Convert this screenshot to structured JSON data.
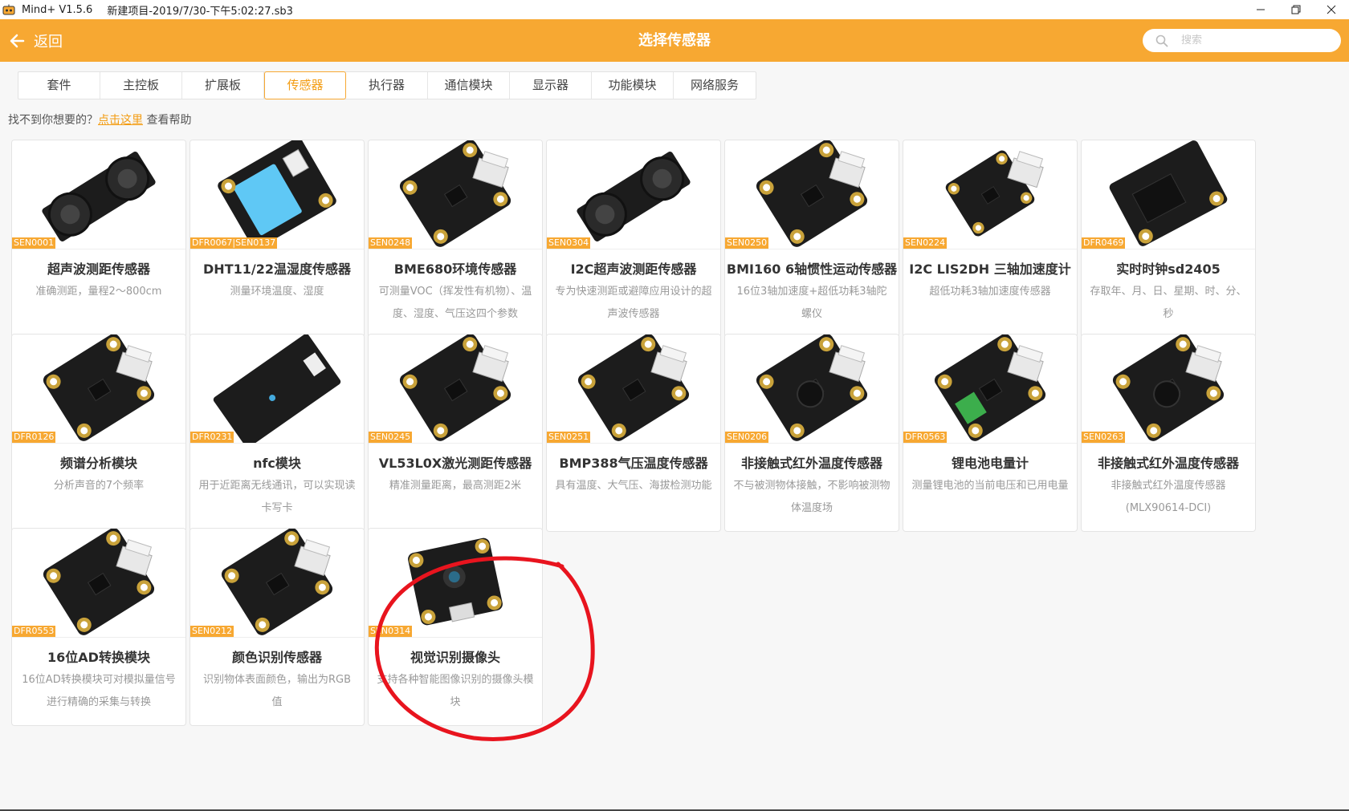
{
  "window": {
    "app_name": "Mind+ V1.5.6",
    "project_name": "新建项目-2019/7/30-下午5:02:27.sb3",
    "controls": [
      "minimize-icon",
      "restore-icon",
      "close-icon"
    ]
  },
  "header": {
    "back_label": "返回",
    "title": "选择传感器",
    "search_placeholder": "搜索",
    "search_value": ""
  },
  "tabs": [
    {
      "label": "套件",
      "active": false
    },
    {
      "label": "主控板",
      "active": false
    },
    {
      "label": "扩展板",
      "active": false
    },
    {
      "label": "传感器",
      "active": true
    },
    {
      "label": "执行器",
      "active": false
    },
    {
      "label": "通信模块",
      "active": false
    },
    {
      "label": "显示器",
      "active": false
    },
    {
      "label": "功能模块",
      "active": false
    },
    {
      "label": "网络服务",
      "active": false
    }
  ],
  "help": {
    "prefix": "找不到你想要的？",
    "link": "点击这里",
    "suffix": " 查看帮助"
  },
  "cards": [
    {
      "sku": "SEN0001",
      "name": "超声波测距传感器",
      "desc": "准确测距，量程2～800cm",
      "board": "ultrasonic"
    },
    {
      "sku": "DFR0067|SEN0137",
      "name": "DHT11/22温湿度传感器",
      "desc": "测量环境温度、湿度",
      "board": "dht"
    },
    {
      "sku": "SEN0248",
      "name": "BME680环境传感器",
      "desc": "可测量VOC（挥发性有机物）、温度、湿度、气压这四个参数",
      "board": "square"
    },
    {
      "sku": "SEN0304",
      "name": "I2C超声波测距传感器",
      "desc": "专为快速测距或避障应用设计的超声波传感器",
      "board": "ultrasonic"
    },
    {
      "sku": "SEN0250",
      "name": "BMI160 6轴惯性运动传感器",
      "desc": "16位3轴加速度+超低功耗3轴陀螺仪",
      "board": "square"
    },
    {
      "sku": "SEN0224",
      "name": "I2C LIS2DH 三轴加速度计",
      "desc": "超低功耗3轴加速度传感器",
      "board": "small"
    },
    {
      "sku": "DFR0469",
      "name": "实时时钟sd2405",
      "desc": "存取年、月、日、星期、时、分、秒",
      "board": "rtc"
    },
    {
      "sku": "DFR0126",
      "name": "频谱分析模块",
      "desc": "分析声音的7个频率",
      "board": "square"
    },
    {
      "sku": "DFR0231",
      "name": "nfc模块",
      "desc": "用于近距离无线通讯，可以实现读卡写卡",
      "board": "nfc"
    },
    {
      "sku": "SEN0245",
      "name": "VL53L0X激光测距传感器",
      "desc": "精准测量距离，最高测距2米",
      "board": "square"
    },
    {
      "sku": "SEN0251",
      "name": "BMP388气压温度传感器",
      "desc": "具有温度、大气压、海拔检测功能",
      "board": "square"
    },
    {
      "sku": "SEN0206",
      "name": "非接触式红外温度传感器",
      "desc": "不与被测物体接触，不影响被测物体温度场",
      "board": "ir"
    },
    {
      "sku": "DFR0563",
      "name": "锂电池电量计",
      "desc": "测量锂电池的当前电压和已用电量",
      "board": "battery"
    },
    {
      "sku": "SEN0263",
      "name": "非接触式红外温度传感器",
      "desc": "非接触式红外温度传感器(MLX90614-DCI)",
      "board": "ir"
    },
    {
      "sku": "DFR0553",
      "name": "16位AD转换模块",
      "desc": "16位AD转换模块可对模拟量信号进行精确的采集与转换",
      "board": "square"
    },
    {
      "sku": "SEN0212",
      "name": "颜色识别传感器",
      "desc": "识别物体表面颜色，输出为RGB值",
      "board": "square"
    },
    {
      "sku": "SEN0314",
      "name": "视觉识别摄像头",
      "desc": "支持各种智能图像识别的摄像头模块",
      "board": "camera"
    }
  ],
  "colors": {
    "accent": "#f7a832",
    "annotation": "#e8141e"
  }
}
